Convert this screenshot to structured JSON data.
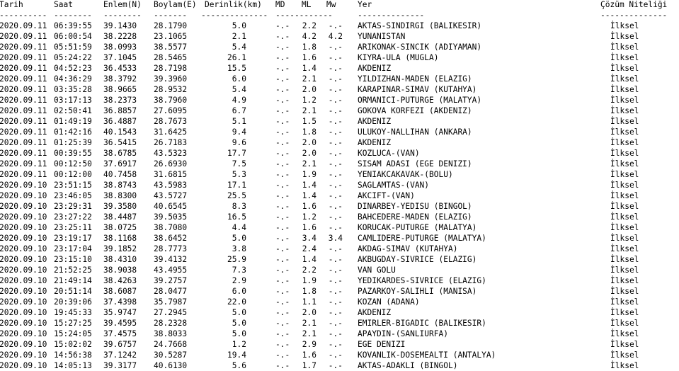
{
  "header": {
    "tarih": "Tarih",
    "saat": "Saat",
    "enlem": "Enlem(N)",
    "boylam": "Boylam(E)",
    "derinlik": "Derinlik(km)",
    "md": "MD",
    "ml": "ML",
    "mw": "Mw",
    "yer": "Yer",
    "cozum": "Çözüm Niteliği"
  },
  "separator": {
    "tarih": "----------",
    "saat": "--------",
    "enlem": "--------",
    "boylam": "-------",
    "derinlik": "--------------",
    "md": "------------",
    "yer": "--------------",
    "cozum": "--------------"
  },
  "rows": [
    {
      "tarih": "2020.09.11",
      "saat": "06:39:55",
      "enlem": "39.1430",
      "boylam": "28.1790",
      "derinlik": "5.0",
      "md": "-.-",
      "ml": "2.2",
      "mw": "-.-",
      "yer": "AKTAS-SINDIRGI (BALIKESIR)",
      "cozum": "İlksel"
    },
    {
      "tarih": "2020.09.11",
      "saat": "06:00:54",
      "enlem": "38.2228",
      "boylam": "23.1065",
      "derinlik": "2.1",
      "md": "-.-",
      "ml": "4.2",
      "mw": "4.2",
      "yer": "YUNANISTAN",
      "cozum": "İlksel"
    },
    {
      "tarih": "2020.09.11",
      "saat": "05:51:59",
      "enlem": "38.0993",
      "boylam": "38.5577",
      "derinlik": "5.4",
      "md": "-.-",
      "ml": "1.8",
      "mw": "-.-",
      "yer": "ARIKONAK-SINCIK (ADIYAMAN)",
      "cozum": "İlksel"
    },
    {
      "tarih": "2020.09.11",
      "saat": "05:24:22",
      "enlem": "37.1045",
      "boylam": "28.5465",
      "derinlik": "26.1",
      "md": "-.-",
      "ml": "1.6",
      "mw": "-.-",
      "yer": "KIYRA-ULA (MUGLA)",
      "cozum": "İlksel"
    },
    {
      "tarih": "2020.09.11",
      "saat": "04:52:23",
      "enlem": "36.4533",
      "boylam": "28.7198",
      "derinlik": "15.5",
      "md": "-.-",
      "ml": "1.4",
      "mw": "-.-",
      "yer": "AKDENIZ",
      "cozum": "İlksel"
    },
    {
      "tarih": "2020.09.11",
      "saat": "04:36:29",
      "enlem": "38.3792",
      "boylam": "39.3960",
      "derinlik": "6.0",
      "md": "-.-",
      "ml": "2.1",
      "mw": "-.-",
      "yer": "YILDIZHAN-MADEN (ELAZIG)",
      "cozum": "İlksel"
    },
    {
      "tarih": "2020.09.11",
      "saat": "03:35:28",
      "enlem": "38.9665",
      "boylam": "28.9532",
      "derinlik": "5.4",
      "md": "-.-",
      "ml": "2.0",
      "mw": "-.-",
      "yer": "KARAPINAR-SIMAV (KUTAHYA)",
      "cozum": "İlksel"
    },
    {
      "tarih": "2020.09.11",
      "saat": "03:17:13",
      "enlem": "38.2373",
      "boylam": "38.7960",
      "derinlik": "4.9",
      "md": "-.-",
      "ml": "1.2",
      "mw": "-.-",
      "yer": "ORMANICI-PUTURGE (MALATYA)",
      "cozum": "İlksel"
    },
    {
      "tarih": "2020.09.11",
      "saat": "02:50:41",
      "enlem": "36.8857",
      "boylam": "27.6095",
      "derinlik": "6.7",
      "md": "-.-",
      "ml": "2.1",
      "mw": "-.-",
      "yer": "GOKOVA KORFEZI (AKDENIZ)",
      "cozum": "İlksel"
    },
    {
      "tarih": "2020.09.11",
      "saat": "01:49:19",
      "enlem": "36.4887",
      "boylam": "28.7673",
      "derinlik": "5.1",
      "md": "-.-",
      "ml": "1.5",
      "mw": "-.-",
      "yer": "AKDENIZ",
      "cozum": "İlksel"
    },
    {
      "tarih": "2020.09.11",
      "saat": "01:42:16",
      "enlem": "40.1543",
      "boylam": "31.6425",
      "derinlik": "9.4",
      "md": "-.-",
      "ml": "1.8",
      "mw": "-.-",
      "yer": "ULUKOY-NALLIHAN (ANKARA)",
      "cozum": "İlksel"
    },
    {
      "tarih": "2020.09.11",
      "saat": "01:25:39",
      "enlem": "36.5415",
      "boylam": "26.7183",
      "derinlik": "9.6",
      "md": "-.-",
      "ml": "2.0",
      "mw": "-.-",
      "yer": "AKDENIZ",
      "cozum": "İlksel"
    },
    {
      "tarih": "2020.09.11",
      "saat": "00:39:55",
      "enlem": "38.6785",
      "boylam": "43.5323",
      "derinlik": "17.7",
      "md": "-.-",
      "ml": "2.0",
      "mw": "-.-",
      "yer": "KOZLUCA-(VAN)",
      "cozum": "İlksel"
    },
    {
      "tarih": "2020.09.11",
      "saat": "00:12:50",
      "enlem": "37.6917",
      "boylam": "26.6930",
      "derinlik": "7.5",
      "md": "-.-",
      "ml": "2.1",
      "mw": "-.-",
      "yer": "SISAM ADASI (EGE DENIZI)",
      "cozum": "İlksel"
    },
    {
      "tarih": "2020.09.11",
      "saat": "00:12:00",
      "enlem": "40.7458",
      "boylam": "31.6815",
      "derinlik": "5.3",
      "md": "-.-",
      "ml": "1.9",
      "mw": "-.-",
      "yer": "YENIAKCAKAVAK-(BOLU)",
      "cozum": "İlksel"
    },
    {
      "tarih": "2020.09.10",
      "saat": "23:51:15",
      "enlem": "38.8743",
      "boylam": "43.5983",
      "derinlik": "17.1",
      "md": "-.-",
      "ml": "1.4",
      "mw": "-.-",
      "yer": "SAGLAMTAS-(VAN)",
      "cozum": "İlksel"
    },
    {
      "tarih": "2020.09.10",
      "saat": "23:46:05",
      "enlem": "38.8300",
      "boylam": "43.5727",
      "derinlik": "25.5",
      "md": "-.-",
      "ml": "1.4",
      "mw": "-.-",
      "yer": "AKCIFT-(VAN)",
      "cozum": "İlksel"
    },
    {
      "tarih": "2020.09.10",
      "saat": "23:29:31",
      "enlem": "39.3580",
      "boylam": "40.6545",
      "derinlik": "8.3",
      "md": "-.-",
      "ml": "1.6",
      "mw": "-.-",
      "yer": "DINARBEY-YEDISU (BINGOL)",
      "cozum": "İlksel"
    },
    {
      "tarih": "2020.09.10",
      "saat": "23:27:22",
      "enlem": "38.4487",
      "boylam": "39.5035",
      "derinlik": "16.5",
      "md": "-.-",
      "ml": "1.2",
      "mw": "-.-",
      "yer": "BAHCEDERE-MADEN (ELAZIG)",
      "cozum": "İlksel"
    },
    {
      "tarih": "2020.09.10",
      "saat": "23:25:11",
      "enlem": "38.0725",
      "boylam": "38.7080",
      "derinlik": "4.4",
      "md": "-.-",
      "ml": "1.6",
      "mw": "-.-",
      "yer": "KORUCAK-PUTURGE (MALATYA)",
      "cozum": "İlksel"
    },
    {
      "tarih": "2020.09.10",
      "saat": "23:19:17",
      "enlem": "38.1168",
      "boylam": "38.6452",
      "derinlik": "5.0",
      "md": "-.-",
      "ml": "3.4",
      "mw": "3.4",
      "yer": "CAMLIDERE-PUTURGE (MALATYA)",
      "cozum": "İlksel"
    },
    {
      "tarih": "2020.09.10",
      "saat": "23:17:04",
      "enlem": "39.1852",
      "boylam": "28.7773",
      "derinlik": "3.8",
      "md": "-.-",
      "ml": "2.4",
      "mw": "-.-",
      "yer": "AKDAG-SIMAV (KUTAHYA)",
      "cozum": "İlksel"
    },
    {
      "tarih": "2020.09.10",
      "saat": "23:15:10",
      "enlem": "38.4310",
      "boylam": "39.4132",
      "derinlik": "25.9",
      "md": "-.-",
      "ml": "1.4",
      "mw": "-.-",
      "yer": "AKBUGDAY-SIVRICE (ELAZIG)",
      "cozum": "İlksel"
    },
    {
      "tarih": "2020.09.10",
      "saat": "21:52:25",
      "enlem": "38.9038",
      "boylam": "43.4955",
      "derinlik": "7.3",
      "md": "-.-",
      "ml": "2.2",
      "mw": "-.-",
      "yer": "VAN GOLU",
      "cozum": "İlksel"
    },
    {
      "tarih": "2020.09.10",
      "saat": "21:49:14",
      "enlem": "38.4263",
      "boylam": "39.2757",
      "derinlik": "2.9",
      "md": "-.-",
      "ml": "1.9",
      "mw": "-.-",
      "yer": "YEDIKARDES-SIVRICE (ELAZIG)",
      "cozum": "İlksel"
    },
    {
      "tarih": "2020.09.10",
      "saat": "20:51:14",
      "enlem": "38.6087",
      "boylam": "28.0477",
      "derinlik": "6.0",
      "md": "-.-",
      "ml": "1.8",
      "mw": "-.-",
      "yer": "PAZARKOY-SALIHLI (MANISA)",
      "cozum": "İlksel"
    },
    {
      "tarih": "2020.09.10",
      "saat": "20:39:06",
      "enlem": "37.4398",
      "boylam": "35.7987",
      "derinlik": "22.0",
      "md": "-.-",
      "ml": "1.1",
      "mw": "-.-",
      "yer": "KOZAN (ADANA)",
      "cozum": "İlksel"
    },
    {
      "tarih": "2020.09.10",
      "saat": "19:45:33",
      "enlem": "35.9747",
      "boylam": "27.2945",
      "derinlik": "5.0",
      "md": "-.-",
      "ml": "2.0",
      "mw": "-.-",
      "yer": "AKDENIZ",
      "cozum": "İlksel"
    },
    {
      "tarih": "2020.09.10",
      "saat": "15:27:25",
      "enlem": "39.4595",
      "boylam": "28.2328",
      "derinlik": "5.0",
      "md": "-.-",
      "ml": "2.1",
      "mw": "-.-",
      "yer": "EMIRLER-BIGADIC (BALIKESIR)",
      "cozum": "İlksel"
    },
    {
      "tarih": "2020.09.10",
      "saat": "15:24:05",
      "enlem": "37.4575",
      "boylam": "38.8033",
      "derinlik": "5.0",
      "md": "-.-",
      "ml": "2.1",
      "mw": "-.-",
      "yer": "APAYDIN-(SANLIURFA)",
      "cozum": "İlksel"
    },
    {
      "tarih": "2020.09.10",
      "saat": "15:02:02",
      "enlem": "39.6757",
      "boylam": "24.7668",
      "derinlik": "1.2",
      "md": "-.-",
      "ml": "2.9",
      "mw": "-.-",
      "yer": "EGE DENIZI",
      "cozum": "İlksel"
    },
    {
      "tarih": "2020.09.10",
      "saat": "14:56:38",
      "enlem": "37.1242",
      "boylam": "30.5287",
      "derinlik": "19.4",
      "md": "-.-",
      "ml": "1.6",
      "mw": "-.-",
      "yer": "KOVANLIK-DOSEMEALTI (ANTALYA)",
      "cozum": "İlksel"
    },
    {
      "tarih": "2020.09.10",
      "saat": "14:05:13",
      "enlem": "39.3177",
      "boylam": "40.6130",
      "derinlik": "5.6",
      "md": "-.-",
      "ml": "1.7",
      "mw": "-.-",
      "yer": "AKTAS-ADAKLI (BINGOL)",
      "cozum": "İlksel"
    }
  ]
}
